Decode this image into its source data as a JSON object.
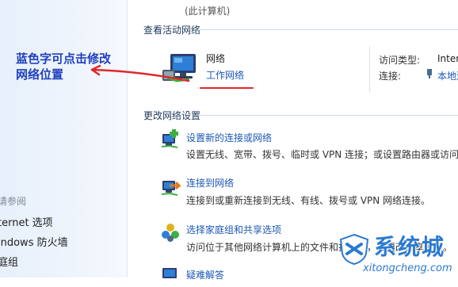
{
  "header": {
    "caption": "(此计算机)"
  },
  "left_pane": {
    "see_also": "请参阅",
    "links": [
      "ternet 选项",
      "indows 防火墙",
      "庭组"
    ]
  },
  "active_networks": {
    "section_title": "查看活动网络",
    "network_name": "网络",
    "network_type": "工作网络",
    "access_type_label": "访问类型:",
    "access_type_value": "Inter",
    "connection_label": "连接:",
    "connection_value": "本地连"
  },
  "change_settings": {
    "section_title": "更改网络设置",
    "tasks": [
      {
        "title": "设置新的连接或网络",
        "desc": "设置无线、宽带、拨号、临时或 VPN 连接；或设置路由器或访问"
      },
      {
        "title": "连接到网络",
        "desc": "连接到或重新连接到无线、有线、拨号或 VPN 网络连接。"
      },
      {
        "title": "选择家庭组和共享选项",
        "desc": "访问位于其他网络计算机上的文件和打印机，或更改共享设置。"
      },
      {
        "title": "疑难解答"
      }
    ]
  },
  "annotation": {
    "line1": "蓝色字可点击修改",
    "line2": "网络位置"
  },
  "watermark": {
    "brand": "系统城",
    "url": "xitongcheng.com"
  },
  "colors": {
    "link_blue": "#1c58b5",
    "annotation_blue": "#1f3fbf",
    "arrow_red": "#e0282a",
    "watermark_blue": "#2b7ad1"
  }
}
